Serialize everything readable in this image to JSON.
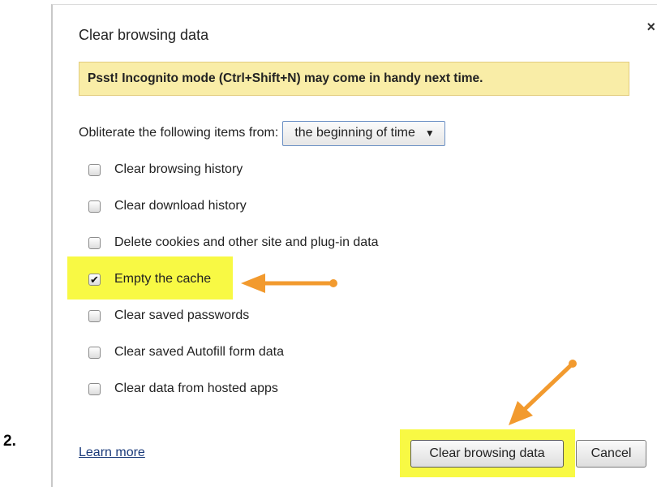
{
  "step_label": "2.",
  "dialog": {
    "title": "Clear browsing data",
    "close_glyph": "×",
    "banner": "Psst! Incognito mode (Ctrl+Shift+N) may come in handy next time.",
    "time_range": {
      "label": "Obliterate the following items from:",
      "selected": "the beginning of time",
      "caret": "▼"
    },
    "checkmark": "✔",
    "options": [
      {
        "label": "Clear browsing history",
        "checked": false
      },
      {
        "label": "Clear download history",
        "checked": false
      },
      {
        "label": "Delete cookies and other site and plug-in data",
        "checked": false
      },
      {
        "label": "Empty the cache",
        "checked": true
      },
      {
        "label": "Clear saved passwords",
        "checked": false
      },
      {
        "label": "Clear saved Autofill form data",
        "checked": false
      },
      {
        "label": "Clear data from hosted apps",
        "checked": false
      }
    ],
    "learn_more": "Learn more",
    "buttons": {
      "clear": "Clear browsing data",
      "cancel": "Cancel"
    }
  },
  "colors": {
    "highlight": "#f8f944",
    "arrow": "#f29a2e",
    "banner_bg": "#f9eda7"
  }
}
